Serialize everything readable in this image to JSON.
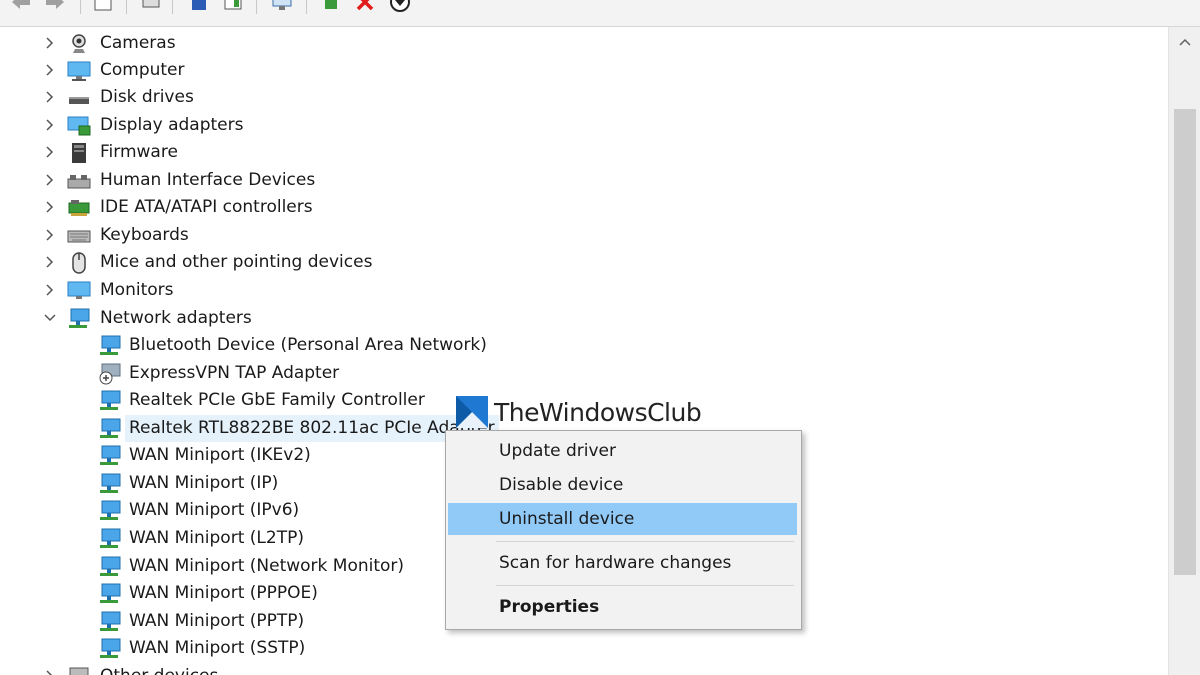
{
  "tree": {
    "items": [
      {
        "label": "Cameras",
        "icon": "camera-icon",
        "expanded": false
      },
      {
        "label": "Computer",
        "icon": "computer-icon",
        "expanded": false
      },
      {
        "label": "Disk drives",
        "icon": "disk-drive-icon",
        "expanded": false
      },
      {
        "label": "Display adapters",
        "icon": "display-adapter-icon",
        "expanded": false
      },
      {
        "label": "Firmware",
        "icon": "firmware-icon",
        "expanded": false
      },
      {
        "label": "Human Interface Devices",
        "icon": "hid-icon",
        "expanded": false
      },
      {
        "label": "IDE ATA/ATAPI controllers",
        "icon": "ide-controller-icon",
        "expanded": false
      },
      {
        "label": "Keyboards",
        "icon": "keyboard-icon",
        "expanded": false
      },
      {
        "label": "Mice and other pointing devices",
        "icon": "mouse-icon",
        "expanded": false
      },
      {
        "label": "Monitors",
        "icon": "monitor-icon",
        "expanded": false
      },
      {
        "label": "Network adapters",
        "icon": "network-adapter-icon",
        "expanded": true
      }
    ],
    "network_children": [
      {
        "label": "Bluetooth Device (Personal Area Network)"
      },
      {
        "label": "ExpressVPN TAP Adapter"
      },
      {
        "label": "Realtek PCIe GbE Family Controller"
      },
      {
        "label": "Realtek RTL8822BE 802.11ac PCIe Adapter",
        "selected": true
      },
      {
        "label": "WAN Miniport (IKEv2)"
      },
      {
        "label": "WAN Miniport (IP)"
      },
      {
        "label": "WAN Miniport (IPv6)"
      },
      {
        "label": "WAN Miniport (L2TP)"
      },
      {
        "label": "WAN Miniport (Network Monitor)"
      },
      {
        "label": "WAN Miniport (PPPOE)"
      },
      {
        "label": "WAN Miniport (PPTP)"
      },
      {
        "label": "WAN Miniport (SSTP)"
      }
    ],
    "partial_last": {
      "label": "Other devices"
    }
  },
  "context_menu": {
    "update": "Update driver",
    "disable": "Disable device",
    "uninstall": "Uninstall device",
    "scan": "Scan for hardware changes",
    "properties": "Properties"
  },
  "watermark": {
    "text": "TheWindowsClub"
  },
  "colors": {
    "highlight": "#91c9f7",
    "selection": "#e5f1fb",
    "net_icon": "#2f8fd6"
  }
}
